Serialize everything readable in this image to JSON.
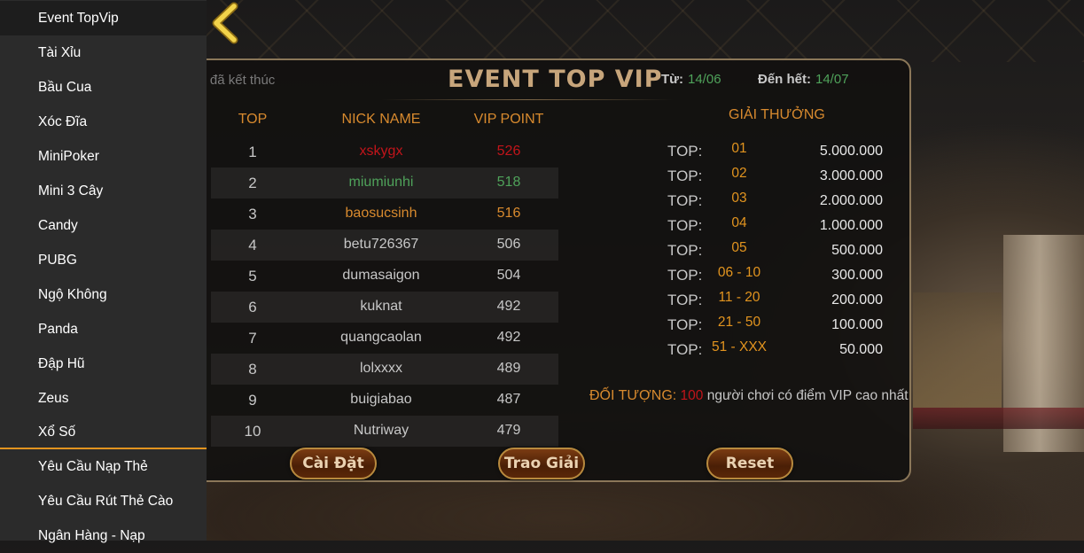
{
  "sidebar": {
    "items": [
      {
        "label": "Event TopVip"
      },
      {
        "label": "Tài Xỉu"
      },
      {
        "label": "Bầu Cua"
      },
      {
        "label": "Xóc Đĩa"
      },
      {
        "label": "MiniPoker"
      },
      {
        "label": "Mini 3 Cây"
      },
      {
        "label": "Candy"
      },
      {
        "label": "PUBG"
      },
      {
        "label": "Ngộ Không"
      },
      {
        "label": "Panda"
      },
      {
        "label": "Đập Hũ"
      },
      {
        "label": "Zeus"
      },
      {
        "label": "Xổ Số"
      },
      {
        "label": "Yêu Cầu Nạp Thẻ"
      },
      {
        "label": "Yêu Cầu Rút Thẻ Cào"
      },
      {
        "label": "Ngân Hàng - Nạp"
      }
    ],
    "active_index": 0
  },
  "event": {
    "title": "EVENT TOP VIP",
    "status": "Sự kiện đã kết thúc",
    "from_label": "Từ:",
    "from_date": "14/06",
    "to_label": "Đến hết:",
    "to_date": "14/07"
  },
  "leaderboard": {
    "headers": {
      "rank": "TOP",
      "nick": "NICK NAME",
      "point": "VIP POINT"
    },
    "rows": [
      {
        "rank": "1",
        "nick": "xskygx",
        "point": "526",
        "color": "#c2141a"
      },
      {
        "rank": "2",
        "nick": "miumiunhi",
        "point": "518",
        "color": "#4fa25a"
      },
      {
        "rank": "3",
        "nick": "baosucsinh",
        "point": "516",
        "color": "#d88a2e"
      },
      {
        "rank": "4",
        "nick": "betu726367",
        "point": "506",
        "color": "#c7c7c7"
      },
      {
        "rank": "5",
        "nick": "dumasaigon",
        "point": "504",
        "color": "#c7c7c7"
      },
      {
        "rank": "6",
        "nick": "kuknat",
        "point": "492",
        "color": "#c7c7c7"
      },
      {
        "rank": "7",
        "nick": "quangcaolan",
        "point": "492",
        "color": "#c7c7c7"
      },
      {
        "rank": "8",
        "nick": "lolxxxx",
        "point": "489",
        "color": "#c7c7c7"
      },
      {
        "rank": "9",
        "nick": "buigiabao",
        "point": "487",
        "color": "#c7c7c7"
      },
      {
        "rank": "10",
        "nick": "Nutriway",
        "point": "479",
        "color": "#c7c7c7"
      }
    ]
  },
  "prizes": {
    "heading": "GIẢI THƯỞNG",
    "top_label": "TOP:",
    "items": [
      {
        "range": "01",
        "amount": "5.000.000"
      },
      {
        "range": "02",
        "amount": "3.000.000"
      },
      {
        "range": "03",
        "amount": "2.000.000"
      },
      {
        "range": "04",
        "amount": "1.000.000"
      },
      {
        "range": "05",
        "amount": "500.000"
      },
      {
        "range": "06 - 10",
        "amount": "300.000"
      },
      {
        "range": "11 - 20",
        "amount": "200.000"
      },
      {
        "range": "21 - 50",
        "amount": "100.000"
      },
      {
        "range": "51 - XXX",
        "amount": "50.000"
      }
    ]
  },
  "target": {
    "label": "ĐỐI TƯỢNG:",
    "count": "100",
    "text": "người chơi có điểm VIP cao nhất"
  },
  "buttons": {
    "settings": "Cài Đặt",
    "award": "Trao Giải",
    "reset": "Reset"
  },
  "icons": {
    "back": "chevron-left-icon"
  },
  "colors": {
    "accent": "#e2941f",
    "gold_title": "#c7a57b",
    "green": "#4fa25a",
    "red": "#c2141a"
  }
}
